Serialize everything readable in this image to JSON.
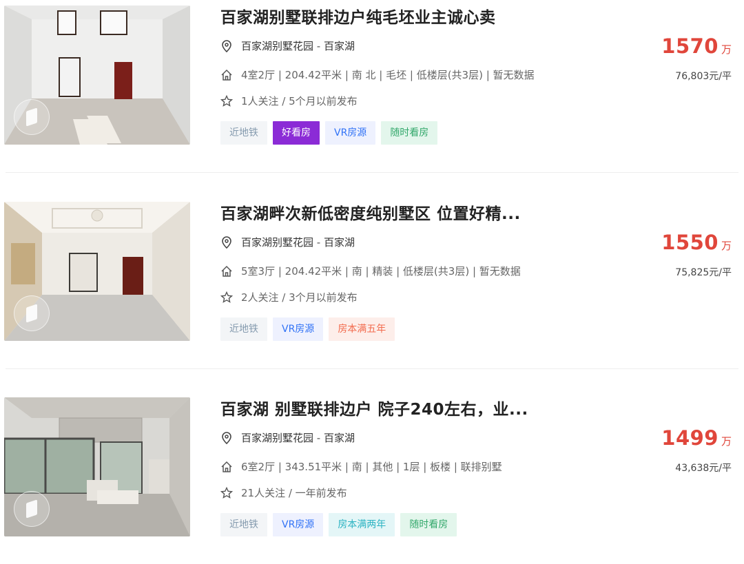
{
  "listings": [
    {
      "title": "百家湖别墅联排边户纯毛坯业主诚心卖",
      "community": "百家湖别墅花园",
      "separator": " - ",
      "area": "百家湖",
      "info": "4室2厅 | 204.42平米 | 南 北 | 毛坯 | 低楼层(共3层) | 暂无数据",
      "follow": "1人关注 / 5个月以前发布",
      "tags": [
        {
          "label": "近地铁",
          "bg": "#f3f5f7",
          "color": "#849aae"
        },
        {
          "label": "好看房",
          "bg": "#8b2bd6",
          "color": "#ffffff"
        },
        {
          "label": "VR房源",
          "bg": "#eef1fe",
          "color": "#3072f6"
        },
        {
          "label": "随时看房",
          "bg": "#e3f6ec",
          "color": "#33a86b"
        }
      ],
      "price": "1570",
      "price_unit": "万",
      "unit_price": "76,803元/平"
    },
    {
      "title": "百家湖畔次新低密度纯别墅区 位置好精...",
      "community": "百家湖别墅花园",
      "separator": " - ",
      "area": "百家湖",
      "info": "5室3厅 | 204.42平米 | 南 | 精装 | 低楼层(共3层) | 暂无数据",
      "follow": "2人关注 / 3个月以前发布",
      "tags": [
        {
          "label": "近地铁",
          "bg": "#f3f5f7",
          "color": "#849aae"
        },
        {
          "label": "VR房源",
          "bg": "#eef1fe",
          "color": "#3072f6"
        },
        {
          "label": "房本满五年",
          "bg": "#fdeeea",
          "color": "#f26b4d"
        }
      ],
      "price": "1550",
      "price_unit": "万",
      "unit_price": "75,825元/平"
    },
    {
      "title": "百家湖 别墅联排边户 院子240左右，业...",
      "community": "百家湖别墅花园",
      "separator": " - ",
      "area": "百家湖",
      "info": "6室2厅 | 343.51平米 | 南 | 其他 | 1层 | 板楼 | 联排别墅",
      "follow": "21人关注 / 一年前发布",
      "tags": [
        {
          "label": "近地铁",
          "bg": "#f3f5f7",
          "color": "#849aae"
        },
        {
          "label": "VR房源",
          "bg": "#eef1fe",
          "color": "#3072f6"
        },
        {
          "label": "房本满两年",
          "bg": "#e4f6f7",
          "color": "#2bb3c2"
        },
        {
          "label": "随时看房",
          "bg": "#e3f6ec",
          "color": "#33a86b"
        }
      ],
      "price": "1499",
      "price_unit": "万",
      "unit_price": "43,638元/平"
    }
  ],
  "icons": {
    "location": "location-pin-icon",
    "house": "house-icon",
    "star": "star-icon",
    "vr": "vr-cube-icon"
  }
}
